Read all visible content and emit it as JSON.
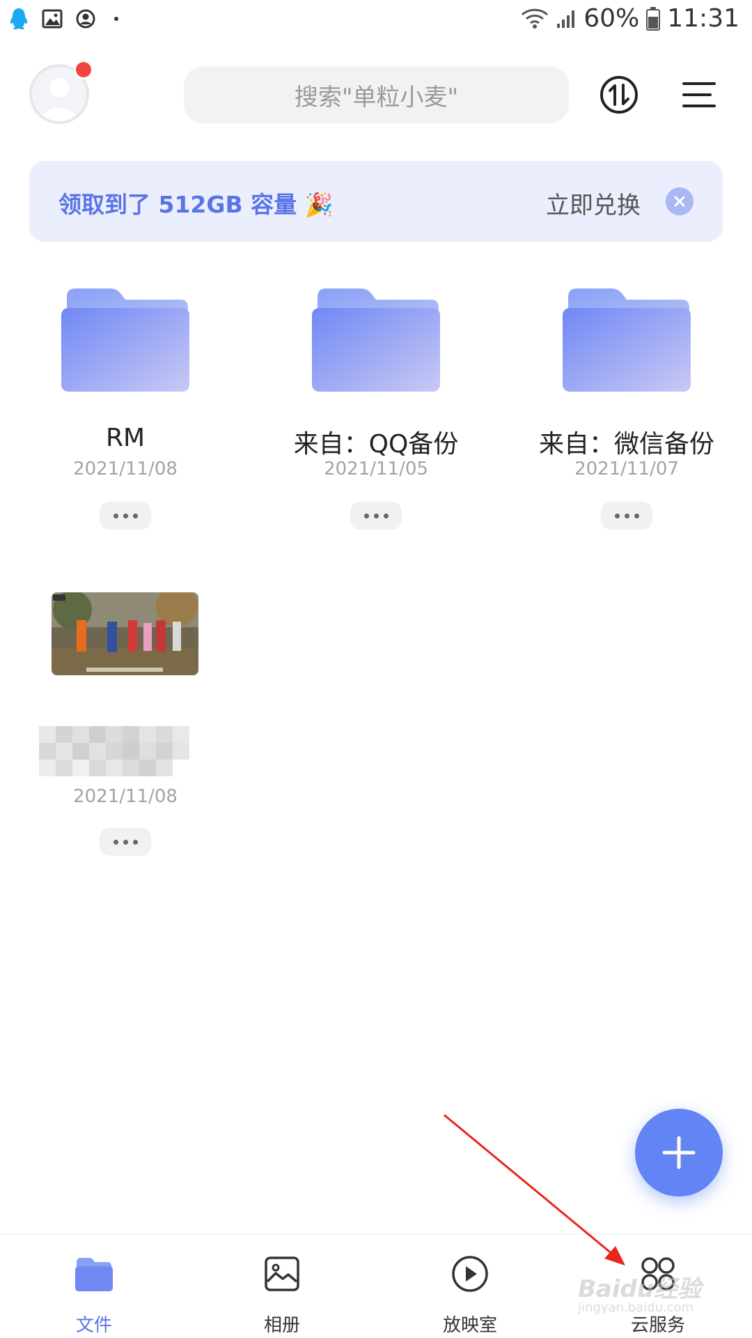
{
  "status_bar": {
    "battery": "60%",
    "time": "11:31"
  },
  "search": {
    "placeholder": "搜索\"单粒小麦\""
  },
  "banner": {
    "text": "领取到了 512GB 容量 🎉",
    "action": "立即兑换"
  },
  "folders": [
    {
      "name": "RM",
      "date": "2021/11/08"
    },
    {
      "name": "来自：QQ备份",
      "date": "2021/11/05"
    },
    {
      "name": "来自：微信备份",
      "date": "2021/11/07"
    }
  ],
  "video_item": {
    "date": "2021/11/08"
  },
  "bottom_nav": [
    {
      "label": "文件",
      "icon": "folder-icon"
    },
    {
      "label": "相册",
      "icon": "album-icon"
    },
    {
      "label": "放映室",
      "icon": "play-icon"
    },
    {
      "label": "云服务",
      "icon": "apps-icon"
    }
  ],
  "watermark": {
    "brand": "Baidu经验",
    "url": "jingyan.baidu.com"
  },
  "colors": {
    "accent": "#5a74e6",
    "fab": "#6284f4",
    "banner_bg": "#eaeefd",
    "badge": "#f0453e",
    "annotation_arrow": "#e8261c"
  }
}
